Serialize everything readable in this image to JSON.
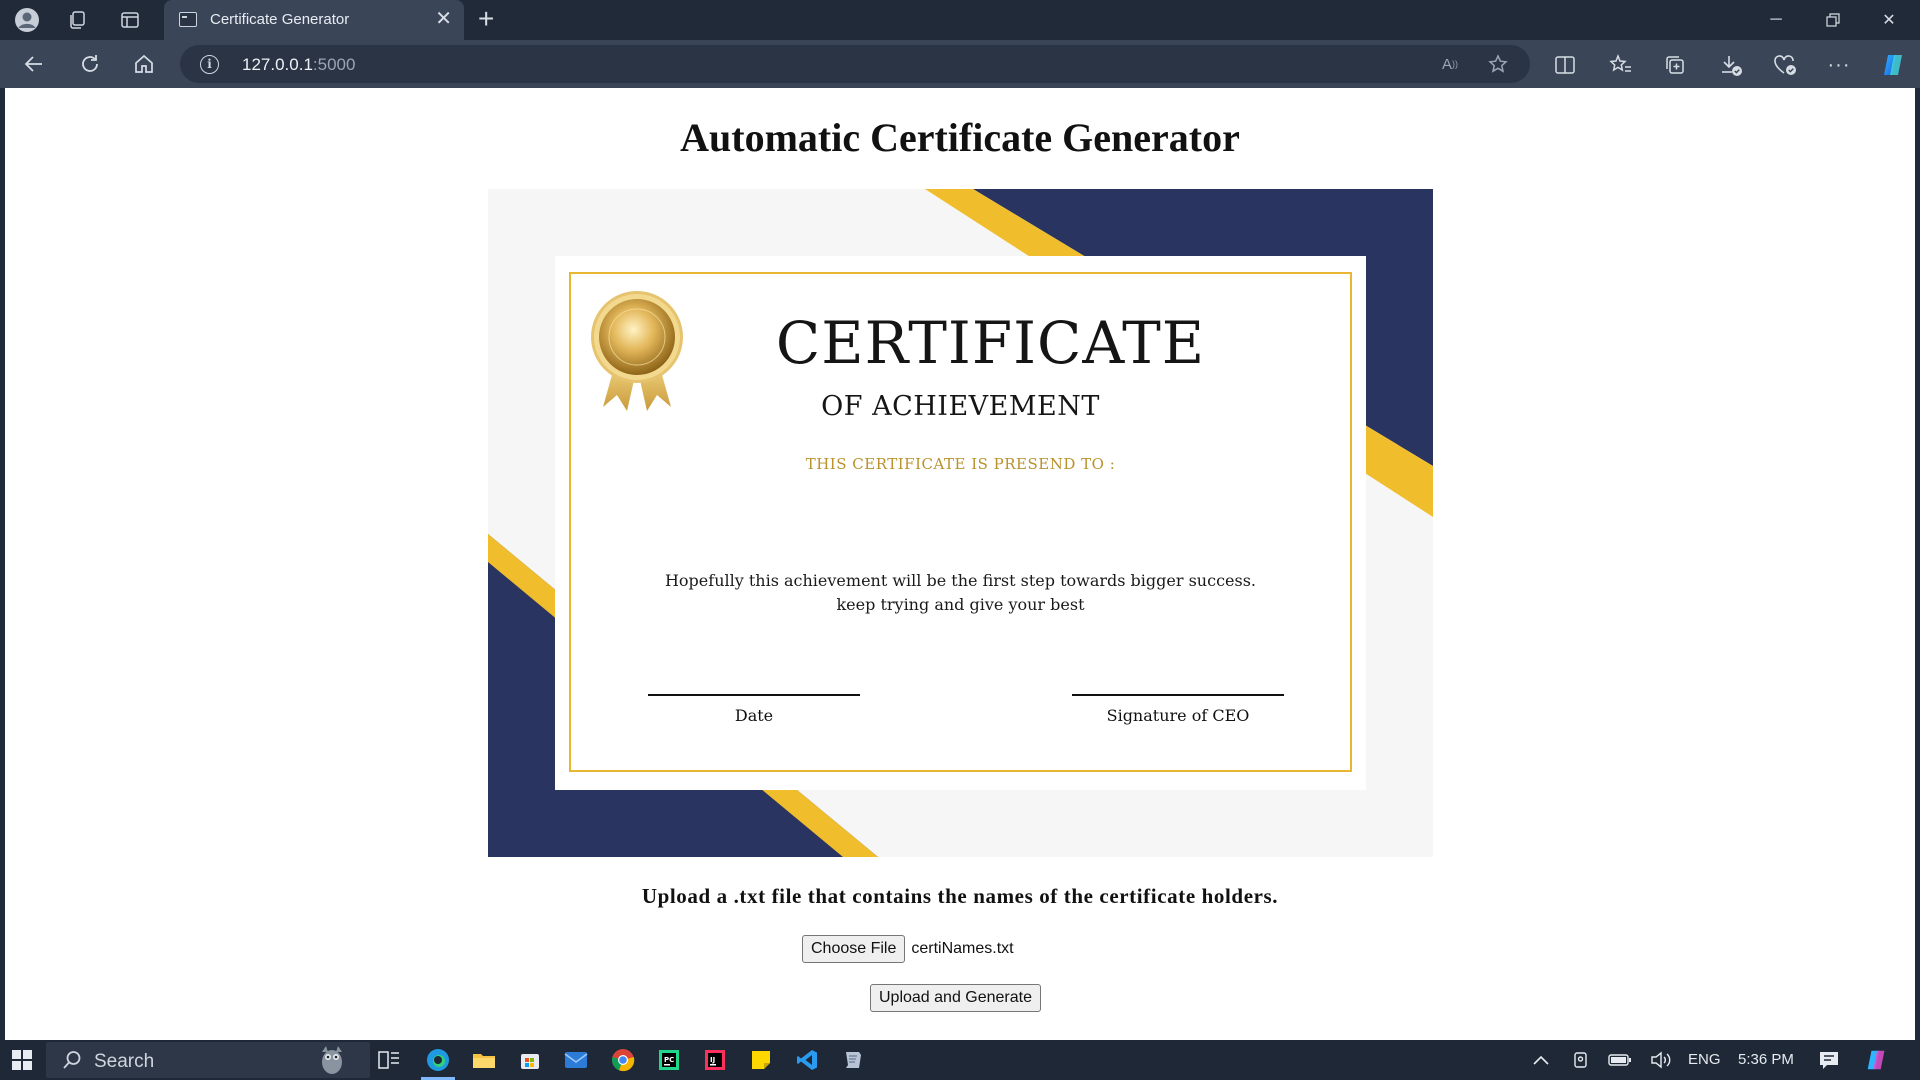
{
  "browser": {
    "tab_title": "Certificate Generator",
    "url_host": "127.0.0.1",
    "url_port": ":5000"
  },
  "page": {
    "title": "Automatic Certificate Generator",
    "upload_heading": "Upload a .txt file that contains the names of the certificate holders.",
    "choose_file_label": "Choose File",
    "selected_file": "certiNames.txt",
    "submit_label": "Upload and Generate"
  },
  "certificate": {
    "heading": "CERTIFICATE",
    "subheading": "OF ACHIEVEMENT",
    "presented_to": "THIS CERTIFICATE IS PRESEND TO :",
    "message_line1": "Hopefully this achievement will be the first step towards bigger success.",
    "message_line2": "keep trying and give your best",
    "date_label": "Date",
    "signature_label": "Signature of CEO",
    "colors": {
      "navy": "#2a3460",
      "gold": "#f0bd2c",
      "frame": "#e9b632"
    }
  },
  "taskbar": {
    "search_label": "Search",
    "language": "ENG",
    "time": "5:36 PM"
  }
}
